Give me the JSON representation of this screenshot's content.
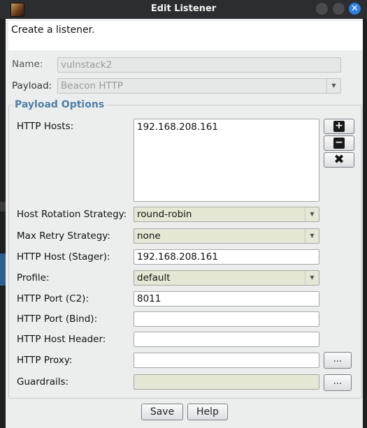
{
  "window": {
    "title": "Edit Listener",
    "close_glyph": "✕"
  },
  "description": "Create a listener.",
  "form": {
    "name_label": "Name:",
    "name_value": "vulnstack2",
    "payload_label": "Payload:",
    "payload_value": "Beacon HTTP"
  },
  "payload_options": {
    "title": "Payload Options",
    "http_hosts_label": "HTTP Hosts:",
    "http_hosts": [
      "192.168.208.161"
    ],
    "add_glyph": "+",
    "remove_glyph": "−",
    "clear_glyph": "✖",
    "host_rotation_label": "Host Rotation Strategy:",
    "host_rotation_value": "round-robin",
    "max_retry_label": "Max Retry Strategy:",
    "max_retry_value": "none",
    "stager_host_label": "HTTP Host (Stager):",
    "stager_host_value": "192.168.208.161",
    "profile_label": "Profile:",
    "profile_value": "default",
    "port_c2_label": "HTTP Port (C2):",
    "port_c2_value": "8011",
    "port_bind_label": "HTTP Port (Bind):",
    "port_bind_value": "",
    "host_header_label": "HTTP Host Header:",
    "host_header_value": "",
    "proxy_label": "HTTP Proxy:",
    "proxy_value": "",
    "proxy_button": "...",
    "guardrails_label": "Guardrails:",
    "guardrails_value": "",
    "guardrails_button": "..."
  },
  "buttons": {
    "save": "Save",
    "help": "Help"
  },
  "dropdown_arrow": "▼"
}
